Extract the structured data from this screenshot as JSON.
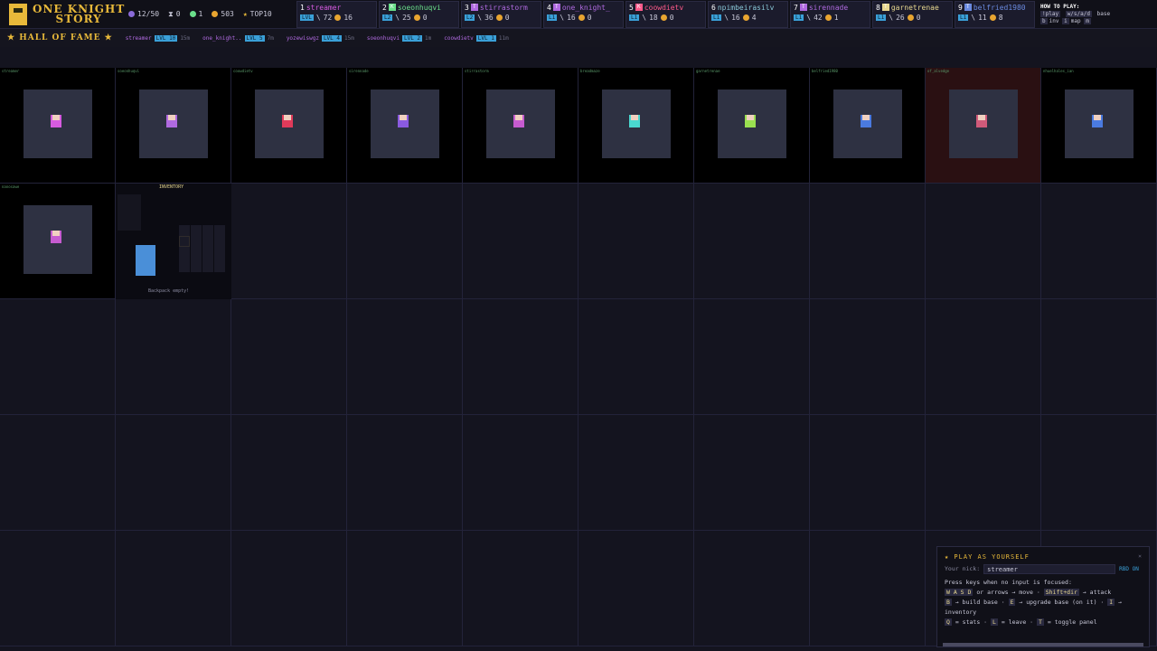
{
  "logo": {
    "line1": "ONE KNIGHT",
    "line2": "STORY"
  },
  "stats": {
    "players": "12/50",
    "time": "0",
    "kills": "1",
    "gold": "503",
    "top": "TOP10"
  },
  "players": [
    {
      "rank": "1",
      "name": "streamer",
      "letter": "",
      "color": "#d65be0",
      "lvl": "LVL",
      "kills": "72",
      "gold": "16"
    },
    {
      "rank": "2",
      "name": "soeonhuqvi",
      "letter": "K",
      "color": "#6adf8a",
      "lvl": "L2",
      "kills": "25",
      "gold": "0"
    },
    {
      "rank": "3",
      "name": "stirrastorm",
      "letter": "T",
      "color": "#b06ae0",
      "lvl": "L2",
      "kills": "36",
      "gold": "0"
    },
    {
      "rank": "4",
      "name": "one_knight_",
      "letter": "T",
      "color": "#b06ae0",
      "lvl": "L1",
      "kills": "16",
      "gold": "0"
    },
    {
      "rank": "5",
      "name": "coowdietv",
      "letter": "K",
      "color": "#ff5a8a",
      "lvl": "L1",
      "kills": "18",
      "gold": "0"
    },
    {
      "rank": "6",
      "name": "npimbeirasilv",
      "letter": "",
      "color": "#8ac8d8",
      "lvl": "L1",
      "kills": "16",
      "gold": "4"
    },
    {
      "rank": "7",
      "name": "sirennade",
      "letter": "T",
      "color": "#b06ae0",
      "lvl": "L1",
      "kills": "42",
      "gold": "1"
    },
    {
      "rank": "8",
      "name": "garnetrenae",
      "letter": "T",
      "color": "#e8d890",
      "lvl": "L1",
      "kills": "26",
      "gold": "0"
    },
    {
      "rank": "9",
      "name": "belfried1980",
      "letter": "T",
      "color": "#6a8adf",
      "lvl": "L1",
      "kills": "11",
      "gold": "8"
    }
  ],
  "howto": {
    "title": "HOW TO PLAY:",
    "play": "!play",
    "wasd": "w/s/a/d",
    "base": "base",
    "b": "b",
    "inv": "inv",
    "i": "i",
    "map": "map",
    "m": "m"
  },
  "hof": {
    "title": "★ HALL OF FAME ★",
    "entries": [
      {
        "name": "streamer",
        "lvl": "LVL 10",
        "extra": "15m"
      },
      {
        "name": "one_knight..",
        "lvl": "LVL 5",
        "extra": "7m"
      },
      {
        "name": "yozewiswgz",
        "lvl": "LVL 4",
        "extra": "15m"
      },
      {
        "name": "soeonhuqvi",
        "lvl": "LVL 2",
        "extra": "1m"
      },
      {
        "name": "coowdietv",
        "lvl": "LVL 1",
        "extra": "11m"
      }
    ]
  },
  "cells": [
    {
      "name": "streamer"
    },
    {
      "name": "soeonhuqvi"
    },
    {
      "name": "coowdietv"
    },
    {
      "name": "sirennade"
    },
    {
      "name": "stirrastorm"
    },
    {
      "name": "breadmaze"
    },
    {
      "name": "garnetrenae"
    },
    {
      "name": "belfried1980"
    },
    {
      "name": "of_alvedge"
    },
    {
      "name": "nhuelhales_ian"
    },
    {
      "name": "nanosawe"
    }
  ],
  "inventory": {
    "title": "INVENTORY",
    "empty": "Backpack empty!",
    "stats": "Lv: 1\nXP: 357/481\nDMG: 36\nDEF: 8\n..."
  },
  "play_panel": {
    "title": "★ PLAY AS YOURSELF",
    "close": "×",
    "nick_label": "Your nick:",
    "nick_value": "streamer",
    "rbd": "RBD ON",
    "intro": "Press keys when no input is focused:",
    "k_wasd": "W A S D",
    "t_move": "or arrows → move",
    "k_shift": "Shift+dir",
    "t_attack": "→ attack",
    "k_b": "B",
    "t_build": "→ build base",
    "k_e": "E",
    "t_upgrade": "→ upgrade base (on it)",
    "k_i": "I",
    "t_inv": "→ inventory",
    "k_q": "Q",
    "t_stats": "= stats",
    "k_l": "L",
    "t_leave": "= leave",
    "k_t": "T",
    "t_toggle": "= toggle panel"
  }
}
